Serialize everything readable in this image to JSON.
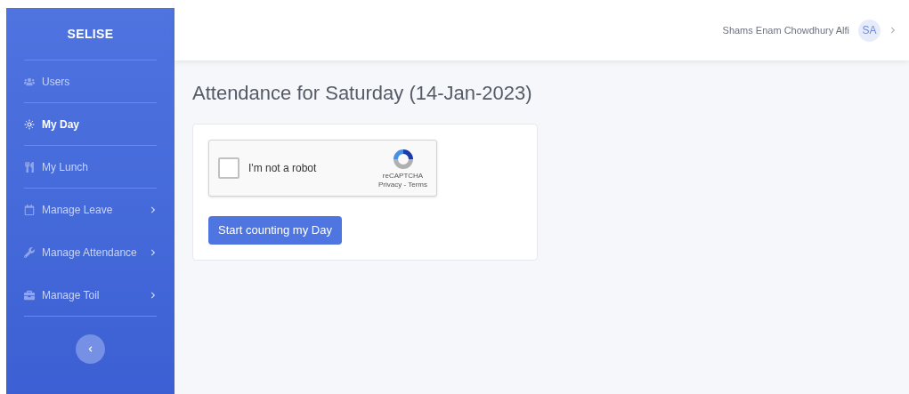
{
  "sidebar": {
    "brand": "SELISE",
    "items": [
      {
        "label": "Users",
        "selected": false,
        "kind": "link"
      },
      {
        "label": "My Day",
        "selected": true,
        "kind": "link"
      },
      {
        "label": "My Lunch",
        "selected": false,
        "kind": "link"
      },
      {
        "label": "Manage Leave",
        "selected": false,
        "kind": "group"
      },
      {
        "label": "Manage Attendance",
        "selected": false,
        "kind": "group"
      },
      {
        "label": "Manage Toil",
        "selected": false,
        "kind": "group"
      }
    ]
  },
  "header": {
    "user_name": "Shams Enam Chowdhury Alfi",
    "avatar": "SA"
  },
  "page": {
    "title": "Attendance for Saturday (14-Jan-2023)",
    "captcha": {
      "label": "I'm not a robot",
      "checked": false,
      "brand": "reCAPTCHA",
      "links": "Privacy - Terms"
    },
    "button": "Start counting my Day"
  }
}
